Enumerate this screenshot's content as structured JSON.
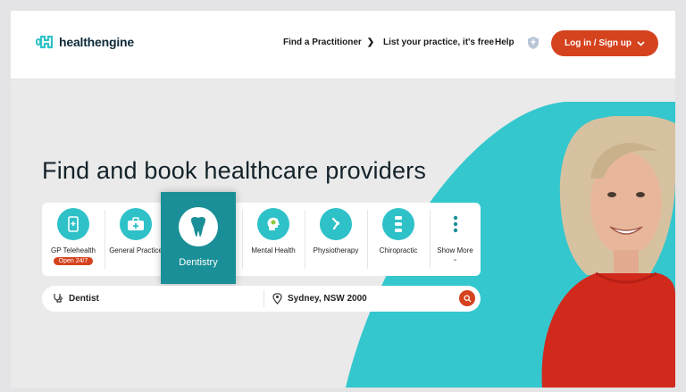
{
  "header": {
    "logo_text": "healthengine",
    "nav": {
      "find_practitioner": "Find a Practitioner",
      "list_practice": "List your practice, it's free",
      "help": "Help"
    },
    "login_label": "Log in / Sign up"
  },
  "hero": {
    "title": "Find and book healthcare providers",
    "categories": [
      {
        "label": "GP Telehealth",
        "badge": "Open 24/7",
        "icon": "phone-plus-icon"
      },
      {
        "label": "General Practice",
        "icon": "medical-bag-icon"
      },
      {
        "label": "Dentistry",
        "icon": "tooth-icon",
        "active": true
      },
      {
        "label": "Mental Health",
        "icon": "head-icon"
      },
      {
        "label": "Physiotherapy",
        "icon": "joint-icon"
      },
      {
        "label": "Chiropractic",
        "icon": "spine-icon"
      },
      {
        "label": "Show More",
        "icon": "more-vertical-icon"
      }
    ],
    "search": {
      "service_value": "Dentist",
      "location_value": "Sydney, NSW 2000"
    }
  },
  "colors": {
    "accent_teal": "#2ec1c8",
    "active_teal": "#1a8f97",
    "brand_orange": "#d5421e"
  }
}
